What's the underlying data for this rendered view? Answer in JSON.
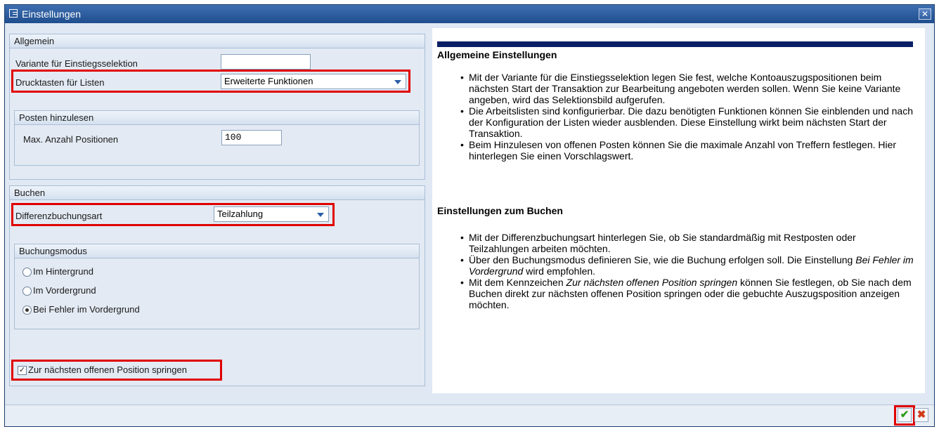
{
  "window": {
    "title": "Einstellungen",
    "close_glyph": "✕"
  },
  "allgemein": {
    "header": "Allgemein",
    "variante_label": "Variante für Einstiegsselektion",
    "variante_value": "",
    "drucktasten_label": "Drucktasten für Listen",
    "drucktasten_value": "Erweiterte Funktionen"
  },
  "posten": {
    "header": "Posten hinzulesen",
    "max_label": "Max. Anzahl Positionen",
    "max_value": "100"
  },
  "buchen": {
    "header": "Buchen",
    "diff_label": "Differenzbuchungsart",
    "diff_value": "Teilzahlung",
    "modus_header": "Buchungsmodus",
    "radios": [
      {
        "label": "Im Hintergrund",
        "selected": false
      },
      {
        "label": "Im Vordergrund",
        "selected": false
      },
      {
        "label": "Bei Fehler im Vordergrund",
        "selected": true
      }
    ],
    "checkbox_label": "Zur nächsten offenen Position springen",
    "checkbox_checked": true
  },
  "help": {
    "heading1": "Allgemeine Einstellungen",
    "b1": "Mit der Variante für die Einstiegsselektion legen Sie fest, welche Kontoauszugspositionen beim nächsten Start der Transaktion zur Bearbeitung angeboten werden sollen. Wenn Sie keine Variante angeben, wird das Selektionsbild aufgerufen.",
    "b2": "Die Arbeitslisten sind konfigurierbar. Die dazu benötigten Funktionen können Sie einblenden und nach der Konfiguration der Listen wieder ausblenden. Diese Einstellung wirkt beim nächsten Start der Transaktion.",
    "b3": "Beim Hinzulesen von offenen Posten können Sie die maximale Anzahl von Treffern festlegen. Hier hinterlegen Sie einen Vorschlagswert.",
    "heading2": "Einstellungen zum Buchen",
    "b4": "Mit der Differenzbuchungsart hinterlegen Sie, ob Sie standardmäßig mit Restposten oder Teilzahlungen arbeiten möchten.",
    "b5_pre": "Über den Buchungsmodus definieren Sie, wie die Buchung erfolgen soll. Die Einstellung ",
    "b5_em": "Bei Fehler im Vordergrund",
    "b5_post": " wird empfohlen.",
    "b6_pre": "Mit dem Kennzeichen ",
    "b6_em": "Zur nächsten offenen Position springen",
    "b6_post": " können Sie festlegen, ob Sie nach dem Buchen direkt zur nächsten offenen Position springen oder die gebuchte Auszugsposition anzeigen möchten."
  },
  "footer": {
    "ok_glyph": "✔",
    "cancel_glyph": "✖"
  },
  "colors": {
    "title_bar": "#2a5a9a",
    "help_bar": "#0b1f66",
    "highlight": "#e00000",
    "ok": "#2e9c1c",
    "cancel": "#d23a1a"
  }
}
